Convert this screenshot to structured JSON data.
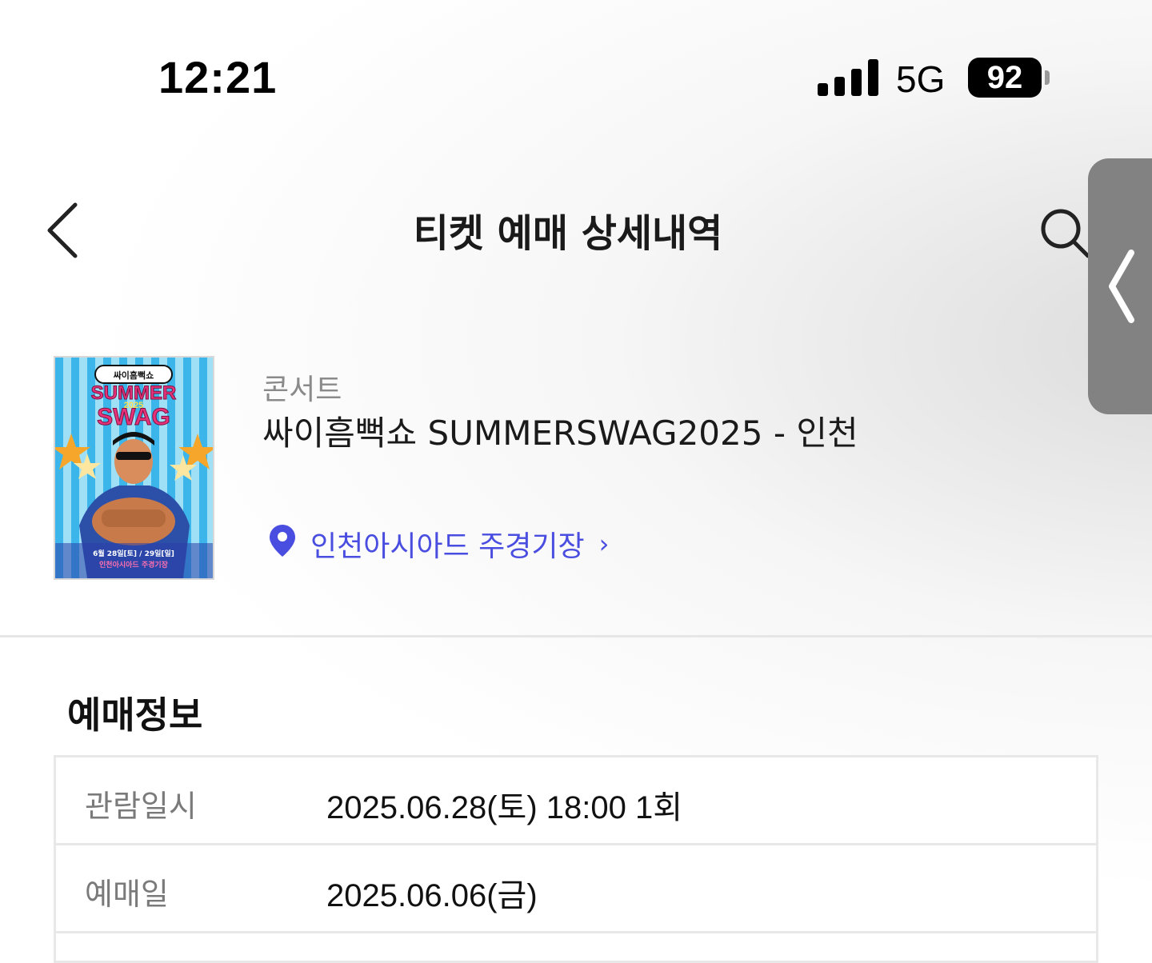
{
  "status_bar": {
    "time": "12:21",
    "network": "5G",
    "battery": "92"
  },
  "header": {
    "title": "티켓 예매 상세내역",
    "back_icon": "chevron-left-icon",
    "search_icon": "search-icon",
    "side_tab_icon": "chevron-left-icon"
  },
  "event": {
    "category": "콘서트",
    "title": "싸이흠뻑쇼 SUMMERSWAG2025 - 인천",
    "venue": "인천아시아드 주경기장",
    "venue_chevron": "›",
    "venue_color": "#4a4ee0",
    "poster": {
      "brand": "싸이흠뻑쇼",
      "headline_1": "SUMMER",
      "year": "2025",
      "headline_2": "SWAG",
      "dates": "6월 28일[토] / 29일[일]",
      "venue_line": "인천아시아드 주경기장"
    }
  },
  "booking_info": {
    "section_title": "예매정보",
    "rows": [
      {
        "label": "관람일시",
        "value": "2025.06.28(토) 18:00 1회"
      },
      {
        "label": "예매일",
        "value": "2025.06.06(금)"
      }
    ]
  }
}
